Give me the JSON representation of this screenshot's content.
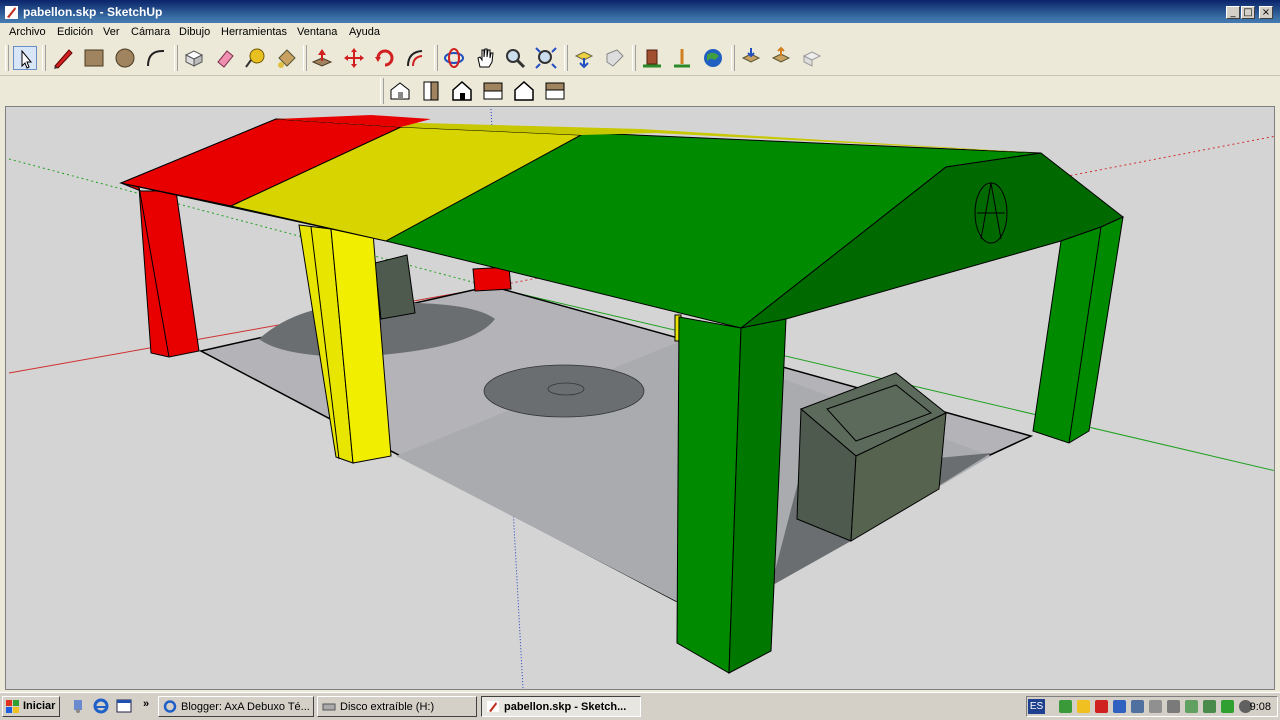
{
  "window": {
    "title": "pabellon.skp - SketchUp",
    "buttons": [
      "_",
      "□",
      "×"
    ]
  },
  "menu": [
    "Archivo",
    "Edición",
    "Ver",
    "Cámara",
    "Dibujo",
    "Herramientas",
    "Ventana",
    "Ayuda"
  ],
  "toolbar_main": [
    "select-icon",
    "pencil-icon",
    "rectangle-icon",
    "circle-icon",
    "arc-icon",
    "make-component-icon",
    "eraser-icon",
    "tape-measure-icon",
    "paint-bucket-icon",
    "push-pull-icon",
    "move-icon",
    "rotate-icon",
    "offset-icon",
    "orbit-icon",
    "pan-icon",
    "zoom-icon",
    "zoom-extents-icon",
    "get-models-icon",
    "share-model-icon",
    "place-model-icon",
    "get-current-view-icon",
    "google-earth-icon",
    "import-icon",
    "export-icon",
    "share-component-icon"
  ],
  "toolbar_views": [
    "iso-view-icon",
    "top-view-icon",
    "front-view-icon",
    "right-view-icon",
    "back-view-icon",
    "left-view-icon"
  ],
  "colors": {
    "roof_red": "#e80000",
    "roof_yellow": "#d8d400",
    "roof_green": "#008a00",
    "roof_green_dark": "#006a00",
    "floor": "#b4b4b8",
    "shadow": "#6b6e70",
    "sky_ground": "#d4d4d4"
  },
  "taskbar": {
    "start_label": "Iniciar",
    "tasks": [
      {
        "label": "Blogger: AxA Debuxo Té...",
        "active": false
      },
      {
        "label": "Disco extraíble (H:)",
        "active": false
      },
      {
        "label": "pabellon.skp - Sketch...",
        "active": true
      }
    ],
    "language": "ES",
    "clock": "9:08"
  }
}
